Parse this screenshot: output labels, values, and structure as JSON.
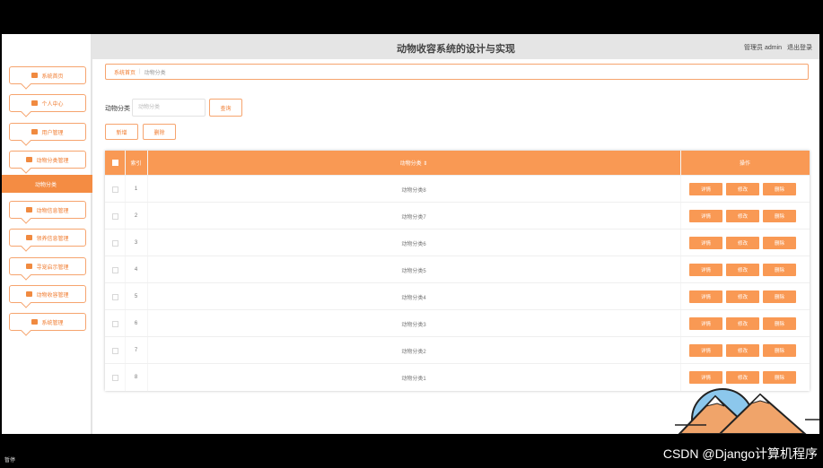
{
  "app": {
    "title": "动物收容系统的设计与实现",
    "user_label": "管理员 admin",
    "logout_label": "退出登录"
  },
  "sidebar": {
    "items": [
      {
        "label": "系统首页",
        "icon": "home-icon"
      },
      {
        "label": "个人中心",
        "icon": "user-icon"
      },
      {
        "label": "用户管理",
        "icon": "users-icon"
      },
      {
        "label": "动物分类管理",
        "icon": "grid-icon"
      }
    ],
    "active_sub": "动物分类",
    "items_after": [
      {
        "label": "动物信息管理",
        "icon": "apps-icon"
      },
      {
        "label": "领养信息管理",
        "icon": "apps-icon"
      },
      {
        "label": "寻宠启示管理",
        "icon": "bell-icon"
      },
      {
        "label": "动物收容管理",
        "icon": "video-icon"
      },
      {
        "label": "系统管理",
        "icon": "calendar-icon"
      }
    ]
  },
  "breadcrumb": {
    "home": "系统首页",
    "current": "动物分类"
  },
  "search": {
    "label": "动物分类",
    "placeholder": "动物分类",
    "button": "查询"
  },
  "toolbar": {
    "add_label": "新增",
    "delete_label": "删除"
  },
  "table": {
    "columns": {
      "index": "索引",
      "category": "动物分类 ⇕",
      "actions": "操作"
    },
    "rows": [
      {
        "index": "1",
        "category": "动物分类8"
      },
      {
        "index": "2",
        "category": "动物分类7"
      },
      {
        "index": "3",
        "category": "动物分类6"
      },
      {
        "index": "4",
        "category": "动物分类5"
      },
      {
        "index": "5",
        "category": "动物分类4"
      },
      {
        "index": "6",
        "category": "动物分类3"
      },
      {
        "index": "7",
        "category": "动物分类2"
      },
      {
        "index": "8",
        "category": "动物分类1"
      }
    ],
    "action_labels": {
      "detail": "详情",
      "edit": "修改",
      "delete": "删除"
    }
  },
  "player": {
    "status": "暂停"
  },
  "watermark": "CSDN @Django计算机程序",
  "colors": {
    "accent": "#f99954",
    "accent_text": "#f07c30",
    "header_bg": "#e5e5e5"
  }
}
